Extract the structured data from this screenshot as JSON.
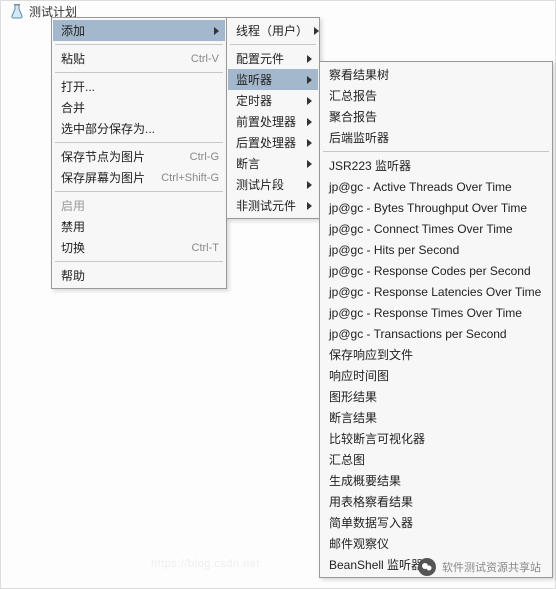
{
  "tree": {
    "root_label": "测试计划"
  },
  "menu1": {
    "items": [
      {
        "label": "添加",
        "shortcut": "",
        "arrow": true,
        "highlighted": true
      },
      {
        "separator": true
      },
      {
        "label": "粘贴",
        "shortcut": "Ctrl-V"
      },
      {
        "separator": true
      },
      {
        "label": "打开...",
        "shortcut": ""
      },
      {
        "label": "合并",
        "shortcut": ""
      },
      {
        "label": "选中部分保存为...",
        "shortcut": ""
      },
      {
        "separator": true
      },
      {
        "label": "保存节点为图片",
        "shortcut": "Ctrl-G"
      },
      {
        "label": "保存屏幕为图片",
        "shortcut": "Ctrl+Shift-G"
      },
      {
        "separator": true
      },
      {
        "label": "启用",
        "shortcut": "",
        "disabled": true
      },
      {
        "label": "禁用",
        "shortcut": ""
      },
      {
        "label": "切换",
        "shortcut": "Ctrl-T"
      },
      {
        "separator": true
      },
      {
        "label": "帮助",
        "shortcut": ""
      }
    ]
  },
  "menu2": {
    "items": [
      {
        "label": "线程（用户）",
        "arrow": true
      },
      {
        "separator": true
      },
      {
        "label": "配置元件",
        "arrow": true
      },
      {
        "label": "监听器",
        "arrow": true,
        "highlighted": true
      },
      {
        "label": "定时器",
        "arrow": true
      },
      {
        "label": "前置处理器",
        "arrow": true
      },
      {
        "label": "后置处理器",
        "arrow": true
      },
      {
        "label": "断言",
        "arrow": true
      },
      {
        "label": "测试片段",
        "arrow": true
      },
      {
        "label": "非测试元件",
        "arrow": true
      }
    ]
  },
  "menu3": {
    "items": [
      {
        "label": "察看结果树"
      },
      {
        "label": "汇总报告"
      },
      {
        "label": "聚合报告"
      },
      {
        "label": "后端监听器"
      },
      {
        "separator": true
      },
      {
        "label": "JSR223 监听器"
      },
      {
        "label": "jp@gc - Active Threads Over Time"
      },
      {
        "label": "jp@gc - Bytes Throughput Over Time"
      },
      {
        "label": "jp@gc - Connect Times Over Time"
      },
      {
        "label": "jp@gc - Hits per Second"
      },
      {
        "label": "jp@gc - Response Codes per Second"
      },
      {
        "label": "jp@gc - Response Latencies Over Time"
      },
      {
        "label": "jp@gc - Response Times Over Time"
      },
      {
        "label": "jp@gc - Transactions per Second"
      },
      {
        "label": "保存响应到文件"
      },
      {
        "label": "响应时间图"
      },
      {
        "label": "图形结果"
      },
      {
        "label": "断言结果"
      },
      {
        "label": "比较断言可视化器"
      },
      {
        "label": "汇总图"
      },
      {
        "label": "生成概要结果"
      },
      {
        "label": "用表格察看结果"
      },
      {
        "label": "简单数据写入器"
      },
      {
        "label": "邮件观察仪"
      },
      {
        "label": "BeanShell 监听器"
      }
    ]
  },
  "watermark": {
    "text": "软件测试资源共享站",
    "url": "https://blog.csdn.net"
  }
}
